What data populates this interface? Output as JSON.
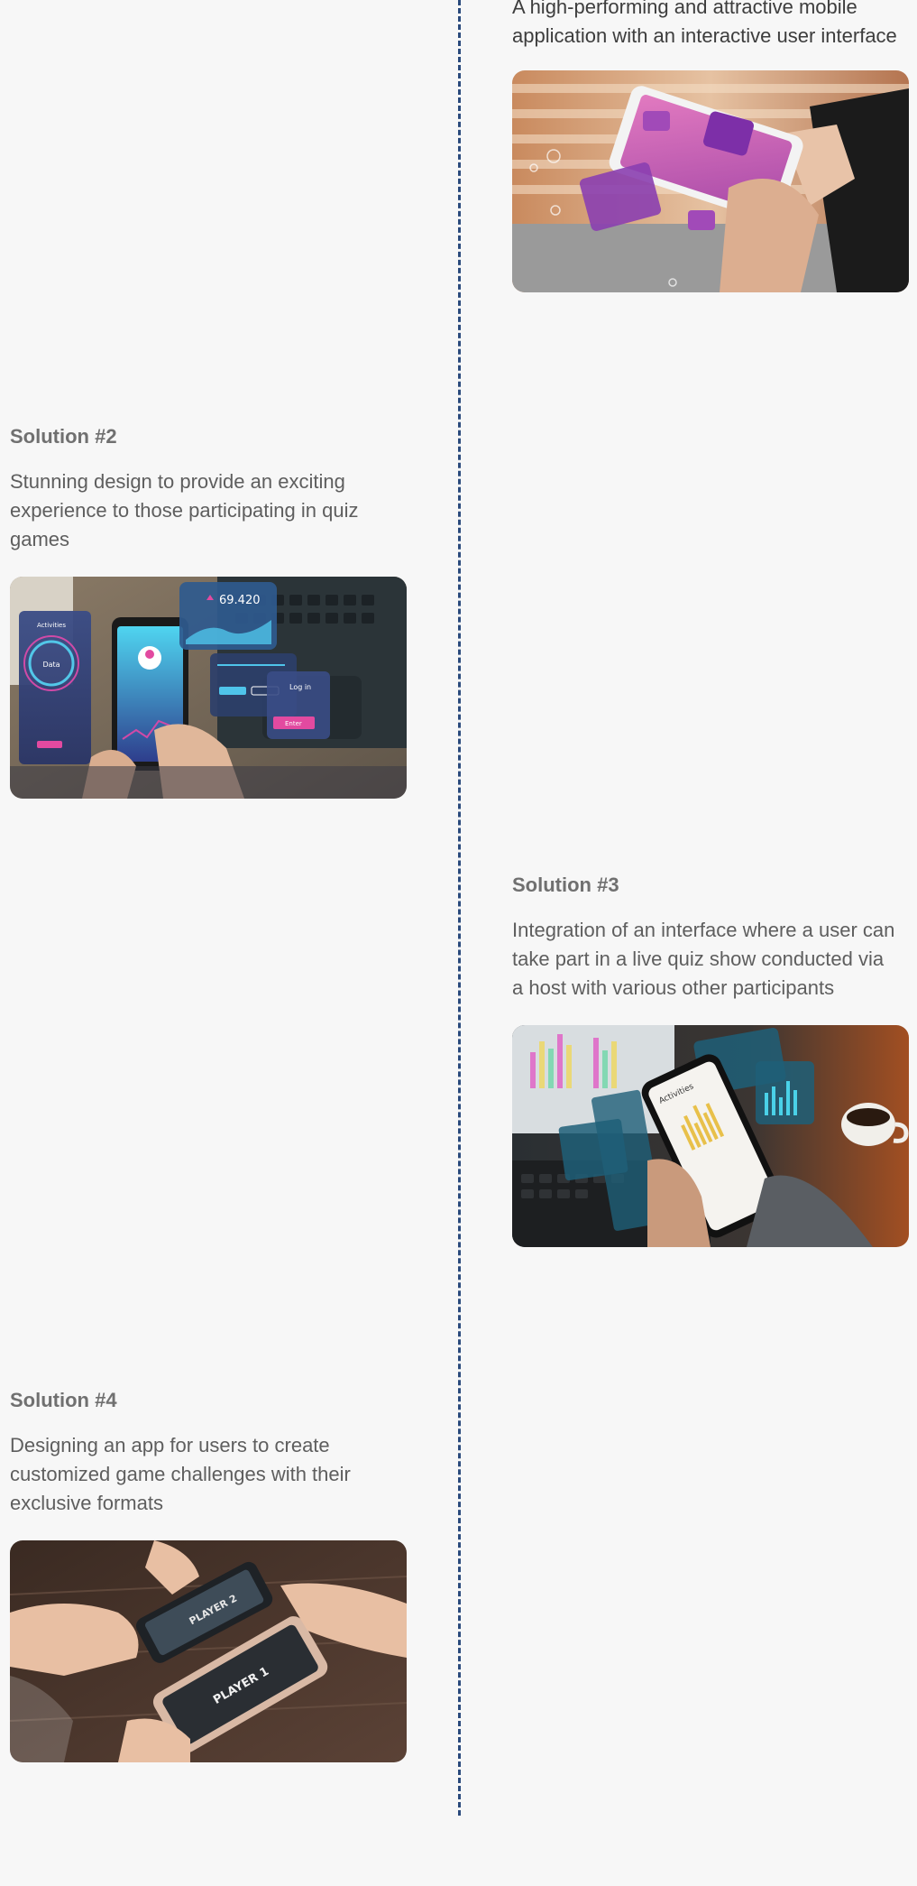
{
  "solution_1": {
    "description": "A high-performing and attractive mobile application with an interactive user interface"
  },
  "solution_2": {
    "title": "Solution #2",
    "description": "Stunning design to provide an exciting experience to those participating in quiz games",
    "image_value": "69.420",
    "image_labels": [
      "Activities",
      "Data",
      "Log in",
      "Enter"
    ]
  },
  "solution_3": {
    "title": "Solution #3",
    "description": "Integration of an interface where a user can take part in a live quiz show conducted via a host with various other participants",
    "image_labels": [
      "Activities"
    ]
  },
  "solution_4": {
    "title": "Solution #4",
    "description": "Designing an app for users to create customized game challenges with their exclusive formats",
    "image_labels": [
      "PLAYER 1",
      "PLAYER 2"
    ]
  },
  "colors": {
    "background": "#f7f7f7",
    "timeline": "#2a4a7c",
    "title": "#707070",
    "text": "#5e5e5e"
  }
}
